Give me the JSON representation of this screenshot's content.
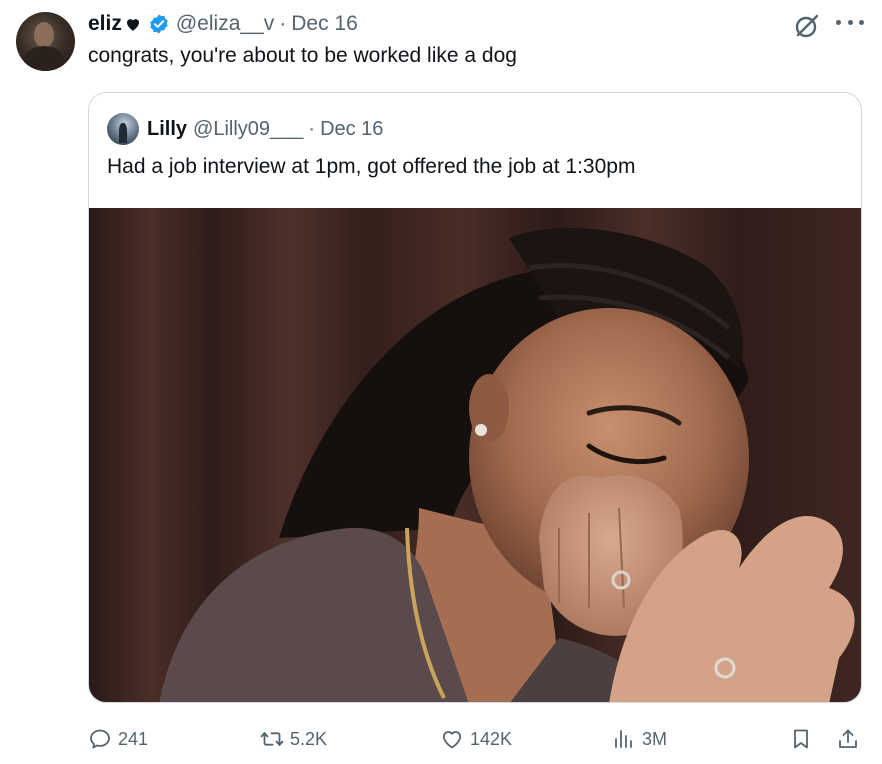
{
  "tweet": {
    "display_name": "eliz",
    "handle": "@eliza__v",
    "separator": "·",
    "date": "Dec 16",
    "text": "congrats, you're about to be worked like a dog"
  },
  "quoted": {
    "display_name": "Lilly",
    "handle": "@Lilly09___",
    "separator": "·",
    "date": "Dec 16",
    "text": "Had a job interview at 1pm, got offered the job at 1:30pm"
  },
  "actions": {
    "replies": "241",
    "reposts": "5.2K",
    "likes": "142K",
    "views": "3M"
  },
  "icons": {
    "name_suffix": "heart-icon",
    "verified": "verified-badge-icon",
    "grok": "grok-icon",
    "more": "more-icon",
    "reply": "reply-icon",
    "retweet": "retweet-icon",
    "like": "heart-icon",
    "views": "views-chart-icon",
    "bookmark": "bookmark-icon",
    "share": "share-icon"
  },
  "colors": {
    "text": "#0f1419",
    "secondary": "#536471",
    "verified": "#1d9bf0",
    "border": "#cfd9de"
  }
}
